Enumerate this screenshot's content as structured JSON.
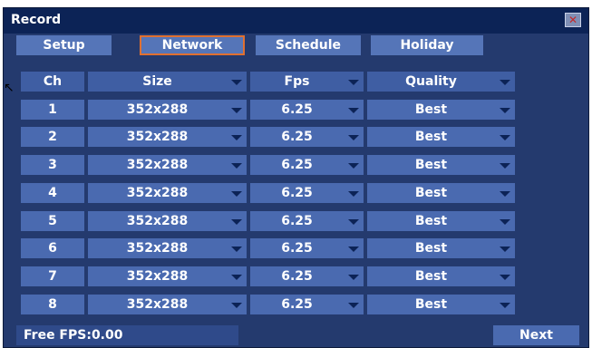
{
  "window": {
    "title": "Record",
    "close_icon": "close-icon"
  },
  "tabs": [
    {
      "label": "Setup",
      "active": false
    },
    {
      "label": "Network",
      "active": true
    },
    {
      "label": "Schedule",
      "active": false
    },
    {
      "label": "Holiday",
      "active": false
    }
  ],
  "table": {
    "headers": {
      "ch": "Ch",
      "size": "Size",
      "fps": "Fps",
      "quality": "Quality"
    },
    "rows": [
      {
        "ch": "1",
        "size": "352x288",
        "fps": "6.25",
        "quality": "Best"
      },
      {
        "ch": "2",
        "size": "352x288",
        "fps": "6.25",
        "quality": "Best"
      },
      {
        "ch": "3",
        "size": "352x288",
        "fps": "6.25",
        "quality": "Best"
      },
      {
        "ch": "4",
        "size": "352x288",
        "fps": "6.25",
        "quality": "Best"
      },
      {
        "ch": "5",
        "size": "352x288",
        "fps": "6.25",
        "quality": "Best"
      },
      {
        "ch": "6",
        "size": "352x288",
        "fps": "6.25",
        "quality": "Best"
      },
      {
        "ch": "7",
        "size": "352x288",
        "fps": "6.25",
        "quality": "Best"
      },
      {
        "ch": "8",
        "size": "352x288",
        "fps": "6.25",
        "quality": "Best"
      }
    ]
  },
  "footer": {
    "free_fps": "Free FPS:0.00",
    "next_label": "Next"
  },
  "colors": {
    "panel": "#243a6e",
    "titlebar": "#0c2356",
    "cell": "#4a6ab0",
    "active_tab_border": "#e07030"
  }
}
